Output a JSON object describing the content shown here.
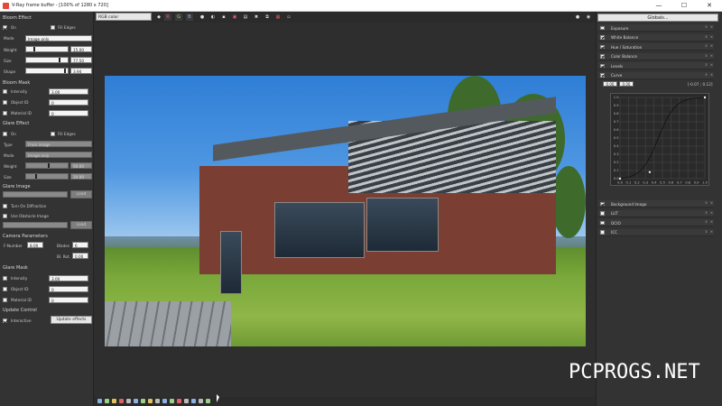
{
  "window": {
    "title": "V-Ray frame buffer - [100% of 1280 x 720]",
    "minimize": "—",
    "maximize": "☐",
    "close": "✕"
  },
  "left": {
    "bloom_effect": {
      "section": "Bloom Effect",
      "on": "On",
      "fill_edges": "Fill Edges",
      "mode_label": "Mode",
      "mode_value": "Image only",
      "weight_label": "Weight",
      "weight_value": "15.00",
      "size_label": "Size",
      "size_value": "77.50",
      "shape_label": "Shape",
      "shape_value": "3.94"
    },
    "bloom_mask": {
      "section": "Bloom Mask",
      "intensity_label": "Intensity",
      "intensity_value": "3.00",
      "objectid_label": "Object ID",
      "objectid_value": "0",
      "materialid_label": "Material ID",
      "materialid_value": "0"
    },
    "glare_effect": {
      "section": "Glare Effect",
      "on": "On",
      "fill_edges": "Fill Edges",
      "type_label": "Type",
      "type_value": "From image",
      "mode_label": "Mode",
      "mode_value": "Image only",
      "weight_label": "Weight",
      "weight_value": "50.00",
      "size_label": "Size",
      "size_value": "20.00"
    },
    "glare_image": {
      "section": "Glare Image",
      "load": "Load",
      "diffraction": "Turn On Diffraction",
      "obstacle": "Use Obstacle Image",
      "load2": "Load"
    },
    "camera": {
      "section": "Camera Parameters",
      "fnumber_label": "F-Number",
      "fnumber_value": "8.00",
      "blades_label": "Blades",
      "blades_value": "6",
      "blrot_label": "Bl. Rot.",
      "blrot_value": "0.00"
    },
    "glare_mask": {
      "section": "Glare Mask",
      "intensity_label": "Intensity",
      "intensity_value": "3.00",
      "objectid_label": "Object ID",
      "objectid_value": "0",
      "materialid_label": "Material ID",
      "materialid_value": "0"
    },
    "update": {
      "section": "Update Control",
      "interactive": "Interactive",
      "update_effects": "Update effects"
    }
  },
  "toolbar": {
    "channel": "RGB color",
    "r": "R",
    "g": "G",
    "b": "B"
  },
  "right": {
    "globals": "Globals...",
    "layers": [
      {
        "name": "Exposure",
        "checked": false
      },
      {
        "name": "White Balance",
        "checked": true
      },
      {
        "name": "Hue / Saturation",
        "checked": true
      },
      {
        "name": "Color Balance",
        "checked": true
      },
      {
        "name": "Levels",
        "checked": true
      },
      {
        "name": "Curve",
        "checked": true
      }
    ],
    "curve": {
      "in1": "0.00",
      "in2": "0.00",
      "coords": "[-0.07 ; 0.12]",
      "xticks": [
        "0.0",
        "0.1",
        "0.2",
        "0.3",
        "0.4",
        "0.5",
        "0.6",
        "0.7",
        "0.8",
        "0.9",
        "1.0"
      ],
      "yticks": [
        "1.0",
        "0.9",
        "0.8",
        "0.7",
        "0.6",
        "0.5",
        "0.4",
        "0.3",
        "0.2",
        "0.1",
        "0.0"
      ]
    },
    "layers2": [
      {
        "name": "Background Image",
        "checked": true
      },
      {
        "name": "LUT",
        "checked": false
      },
      {
        "name": "OCIO",
        "checked": false
      },
      {
        "name": "ICC",
        "checked": false
      }
    ]
  },
  "watermark": "PCPROGS.NET"
}
